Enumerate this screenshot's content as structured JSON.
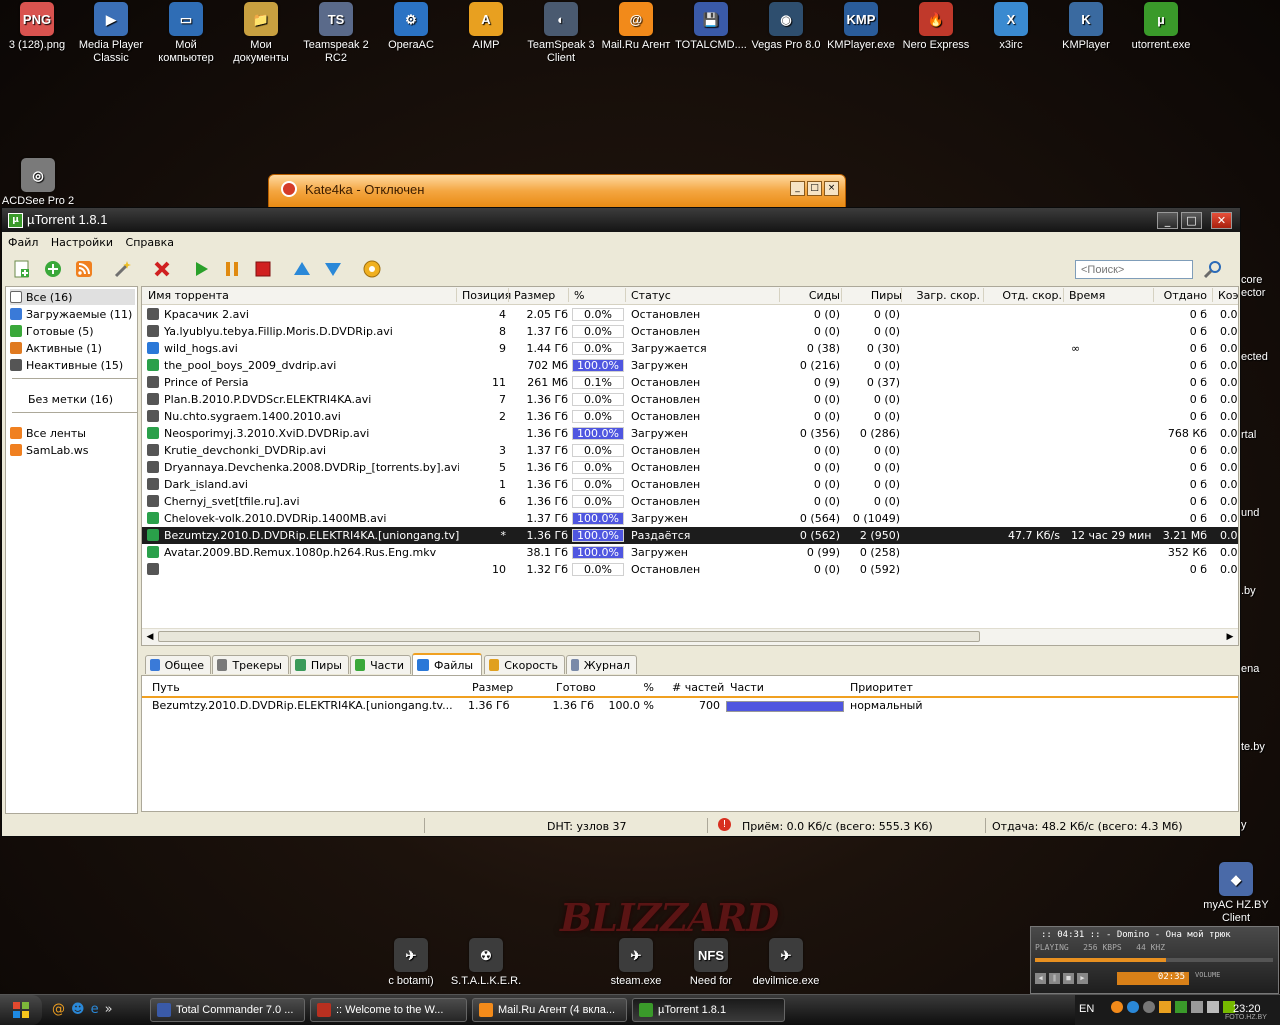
{
  "desktop": {
    "icons": [
      {
        "label": "3 (128).png",
        "color": "#d9534f",
        "glyph": "PNG"
      },
      {
        "label": "Media Player Classic",
        "color": "#3b6fb6",
        "glyph": "▶"
      },
      {
        "label": "Мой компьютер",
        "color": "#2f6db5",
        "glyph": "▭"
      },
      {
        "label": "Мои документы",
        "color": "#c8a040",
        "glyph": "📁"
      },
      {
        "label": "Teamspeak 2 RC2",
        "color": "#5a6a8a",
        "glyph": "TS"
      },
      {
        "label": "OperaAC",
        "color": "#2b73c4",
        "glyph": "⚙"
      },
      {
        "label": "AIMP",
        "color": "#e8a020",
        "glyph": "A"
      },
      {
        "label": "TeamSpeak 3 Client",
        "color": "#4a5a70",
        "glyph": "◐"
      },
      {
        "label": "Mail.Ru Агент",
        "color": "#f28a1a",
        "glyph": "@"
      },
      {
        "label": "TOTALCMD....",
        "color": "#3a5aa8",
        "glyph": "💾"
      },
      {
        "label": "Vegas Pro 8.0",
        "color": "#2e4e6e",
        "glyph": "◉"
      },
      {
        "label": "KMPlayer.exe",
        "color": "#2a5c9a",
        "glyph": "KMP"
      },
      {
        "label": "Nero Express",
        "color": "#c0392b",
        "glyph": "🔥"
      },
      {
        "label": "x3irc",
        "color": "#3a8ad0",
        "glyph": "X"
      },
      {
        "label": "KMPlayer",
        "color": "#3a6aa0",
        "glyph": "K"
      },
      {
        "label": "utorrent.exe",
        "color": "#3a9a2a",
        "glyph": "µ"
      }
    ],
    "acdsee_label": "ACDSee Pro 2",
    "right_edge": [
      "core",
      "ector",
      "ected",
      "rtal",
      "und",
      ".by",
      "ena",
      "te.by",
      "y"
    ],
    "myac_label": "myAC HZ.BY Client",
    "bottom_icons": [
      {
        "label": "c botami)",
        "glyph": "✈"
      },
      {
        "label": "S.T.A.L.K.E.R.",
        "glyph": "☢"
      },
      {
        "label": "steam.exe",
        "glyph": "✈"
      },
      {
        "label": "Need for",
        "glyph": "NFS"
      },
      {
        "label": "devilmice.exe",
        "glyph": "✈"
      }
    ],
    "blizzard_text": "BLIZZARD"
  },
  "kate": {
    "title": "Kate4ka - Отключен"
  },
  "utorrent": {
    "title": "µTorrent 1.8.1",
    "menu": [
      "Файл",
      "Настройки",
      "Справка"
    ],
    "search_placeholder": "<Поиск>",
    "sidebar": {
      "items": [
        {
          "label": "Все (16)",
          "color": "#333"
        },
        {
          "label": "Загружаемые (11)",
          "color": "#3a7ad8"
        },
        {
          "label": "Готовые (5)",
          "color": "#3aa83a"
        },
        {
          "label": "Активные (1)",
          "color": "#e07a20"
        },
        {
          "label": "Неактивные (15)",
          "color": "#555"
        }
      ],
      "label_item": "Без метки (16)",
      "feeds": [
        "Все ленты",
        "SamLab.ws"
      ]
    },
    "columns": [
      "Имя торрента",
      "Позиция",
      "Размер",
      "%",
      "Статус",
      "Сиды",
      "Пиры",
      "Загр. скор.",
      "Отд. скор.",
      "Время",
      "Отдано",
      "Коэ."
    ],
    "torrents": [
      {
        "name": "Красачик 2.avi",
        "pos": "4",
        "size": "2.05 Гб",
        "pct": "0.0%",
        "progress": 0,
        "status": "Остановлен",
        "seeds": "0 (0)",
        "peers": "0 (0)",
        "down": "",
        "up": "",
        "eta": "",
        "uploaded": "0 б",
        "ratio": "0.0",
        "kind": "stopped"
      },
      {
        "name": "Ya.lyublyu.tebya.Fillip.Moris.D.DVDRip.avi",
        "pos": "8",
        "size": "1.37 Гб",
        "pct": "0.0%",
        "progress": 0,
        "status": "Остановлен",
        "seeds": "0 (0)",
        "peers": "0 (0)",
        "down": "",
        "up": "",
        "eta": "",
        "uploaded": "0 б",
        "ratio": "0.0",
        "kind": "stopped"
      },
      {
        "name": "wild_hogs.avi",
        "pos": "9",
        "size": "1.44 Гб",
        "pct": "0.0%",
        "progress": 0,
        "status": "Загружается",
        "seeds": "0 (38)",
        "peers": "0 (30)",
        "down": "",
        "up": "",
        "eta": "∞",
        "uploaded": "0 б",
        "ratio": "0.0",
        "kind": "downloading"
      },
      {
        "name": "the_pool_boys_2009_dvdrip.avi",
        "pos": "",
        "size": "702 Мб",
        "pct": "100.0%",
        "progress": 1,
        "status": "Загружен",
        "seeds": "0 (216)",
        "peers": "0 (0)",
        "down": "",
        "up": "",
        "eta": "",
        "uploaded": "0 б",
        "ratio": "0.0",
        "kind": "done"
      },
      {
        "name": "Prince of Persia",
        "pos": "11",
        "size": "261 Мб",
        "pct": "0.1%",
        "progress": 0.001,
        "status": "Остановлен",
        "seeds": "0 (9)",
        "peers": "0 (37)",
        "down": "",
        "up": "",
        "eta": "",
        "uploaded": "0 б",
        "ratio": "0.0",
        "kind": "stopped"
      },
      {
        "name": "Plan.B.2010.P.DVDScr.ELEKTRI4KA.avi",
        "pos": "7",
        "size": "1.36 Гб",
        "pct": "0.0%",
        "progress": 0,
        "status": "Остановлен",
        "seeds": "0 (0)",
        "peers": "0 (0)",
        "down": "",
        "up": "",
        "eta": "",
        "uploaded": "0 б",
        "ratio": "0.0",
        "kind": "stopped"
      },
      {
        "name": "Nu.chto.sygraem.1400.2010.avi",
        "pos": "2",
        "size": "1.36 Гб",
        "pct": "0.0%",
        "progress": 0,
        "status": "Остановлен",
        "seeds": "0 (0)",
        "peers": "0 (0)",
        "down": "",
        "up": "",
        "eta": "",
        "uploaded": "0 б",
        "ratio": "0.0",
        "kind": "stopped"
      },
      {
        "name": "Neosporimyj.3.2010.XviD.DVDRip.avi",
        "pos": "",
        "size": "1.36 Гб",
        "pct": "100.0%",
        "progress": 1,
        "status": "Загружен",
        "seeds": "0 (356)",
        "peers": "0 (286)",
        "down": "",
        "up": "",
        "eta": "",
        "uploaded": "768 Кб",
        "ratio": "0.0",
        "kind": "done"
      },
      {
        "name": "Krutie_devchonki_DVDRip.avi",
        "pos": "3",
        "size": "1.37 Гб",
        "pct": "0.0%",
        "progress": 0,
        "status": "Остановлен",
        "seeds": "0 (0)",
        "peers": "0 (0)",
        "down": "",
        "up": "",
        "eta": "",
        "uploaded": "0 б",
        "ratio": "0.0",
        "kind": "stopped"
      },
      {
        "name": "Dryannaya.Devchenka.2008.DVDRip_[torrents.by].avi",
        "pos": "5",
        "size": "1.36 Гб",
        "pct": "0.0%",
        "progress": 0,
        "status": "Остановлен",
        "seeds": "0 (0)",
        "peers": "0 (0)",
        "down": "",
        "up": "",
        "eta": "",
        "uploaded": "0 б",
        "ratio": "0.0",
        "kind": "stopped"
      },
      {
        "name": "Dark_island.avi",
        "pos": "1",
        "size": "1.36 Гб",
        "pct": "0.0%",
        "progress": 0,
        "status": "Остановлен",
        "seeds": "0 (0)",
        "peers": "0 (0)",
        "down": "",
        "up": "",
        "eta": "",
        "uploaded": "0 б",
        "ratio": "0.0",
        "kind": "stopped"
      },
      {
        "name": "Chernyj_svet[tfile.ru].avi",
        "pos": "6",
        "size": "1.36 Гб",
        "pct": "0.0%",
        "progress": 0,
        "status": "Остановлен",
        "seeds": "0 (0)",
        "peers": "0 (0)",
        "down": "",
        "up": "",
        "eta": "",
        "uploaded": "0 б",
        "ratio": "0.0",
        "kind": "stopped"
      },
      {
        "name": "Chelovek-volk.2010.DVDRip.1400MB.avi",
        "pos": "",
        "size": "1.37 Гб",
        "pct": "100.0%",
        "progress": 1,
        "status": "Загружен",
        "seeds": "0 (564)",
        "peers": "0 (1049)",
        "down": "",
        "up": "",
        "eta": "",
        "uploaded": "0 б",
        "ratio": "0.0",
        "kind": "done"
      },
      {
        "name": "Bezumtzy.2010.D.DVDRip.ELEKTRI4KA.[uniongang.tv].avi",
        "pos": "*",
        "size": "1.36 Гб",
        "pct": "100.0%",
        "progress": 1,
        "status": "Раздаётся",
        "seeds": "0 (562)",
        "peers": "2 (950)",
        "down": "",
        "up": "47.7 Кб/s",
        "eta": "12 час 29 мин",
        "uploaded": "3.21 Мб",
        "ratio": "0.0",
        "kind": "seeding",
        "selected": true
      },
      {
        "name": "Avatar.2009.BD.Remux.1080p.h264.Rus.Eng.mkv",
        "pos": "",
        "size": "38.1 Гб",
        "pct": "100.0%",
        "progress": 1,
        "status": "Загружен",
        "seeds": "0 (99)",
        "peers": "0 (258)",
        "down": "",
        "up": "",
        "eta": "",
        "uploaded": "352 Кб",
        "ratio": "0.0",
        "kind": "done"
      },
      {
        "name": "",
        "pos": "10",
        "size": "1.32 Гб",
        "pct": "0.0%",
        "progress": 0,
        "status": "Остановлен",
        "seeds": "0 (0)",
        "peers": "0 (592)",
        "down": "",
        "up": "",
        "eta": "",
        "uploaded": "0 б",
        "ratio": "0.0",
        "kind": "stopped"
      }
    ],
    "tabs": [
      "Общее",
      "Трекеры",
      "Пиры",
      "Части",
      "Файлы",
      "Скорость",
      "Журнал"
    ],
    "active_tab": "Файлы",
    "file_columns": [
      "Путь",
      "Размер",
      "Готово",
      "%",
      "# частей",
      "Части",
      "Приоритет"
    ],
    "file_row": {
      "path": "Bezumtzy.2010.D.DVDRip.ELEKTRI4KA.[uniongang.tv...",
      "size": "1.36 Гб",
      "done": "1.36 Гб",
      "pct": "100.0 %",
      "pieces": "700",
      "parts_progress": 1,
      "priority": "нормальный"
    },
    "status": {
      "dht": "DHT: узлов 37",
      "receive": "Приём: 0.0 Кб/с (всего: 555.3 Кб)",
      "send": "Отдача: 48.2 Кб/с (всего: 4.3 Мб)"
    },
    "colors": {
      "progress": "#4f56e0",
      "accent": "#f0a020"
    }
  },
  "player": {
    "time": ":: 04:31 ::",
    "track": "- Domino - Она мой трюк",
    "state": "PLAYING",
    "kbps": "256 KBPS",
    "khz": "44 KHZ",
    "counter": "02:35",
    "volume_label": "VOLUME"
  },
  "taskbar": {
    "buttons": [
      {
        "label": "Total Commander 7.0 ...",
        "color": "#3a5aa8"
      },
      {
        "label": ":: Welcome to the W...",
        "color": "#b83020"
      },
      {
        "label": "Mail.Ru Агент (4 вкла...",
        "color": "#f28a1a"
      },
      {
        "label": "µTorrent 1.8.1",
        "color": "#3a9a2a"
      }
    ],
    "lang": "EN",
    "clock": "23:20",
    "watermark": "FOTO.HZ.BY"
  }
}
